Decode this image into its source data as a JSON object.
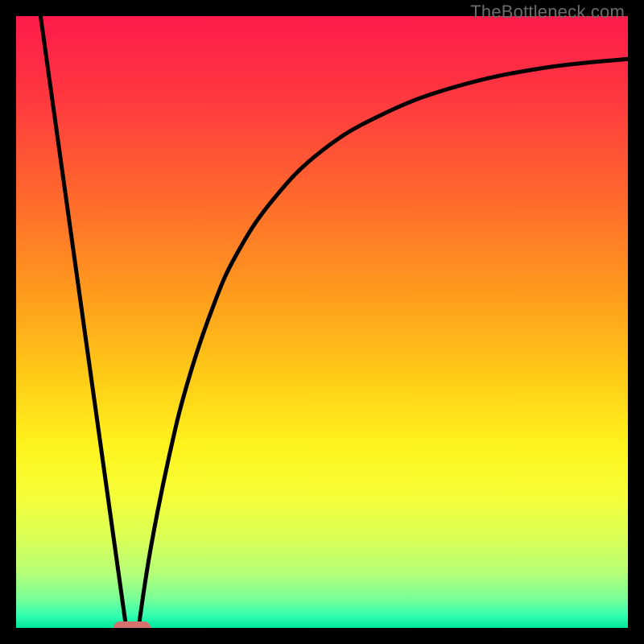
{
  "watermark": "TheBottleneck.com",
  "chart_data": {
    "type": "line",
    "title": "",
    "xlabel": "",
    "ylabel": "",
    "xlim": [
      0,
      100
    ],
    "ylim": [
      0,
      100
    ],
    "grid": false,
    "legend": false,
    "gradient_stops": [
      {
        "offset": 0.0,
        "color": "#ff1a4b"
      },
      {
        "offset": 0.14,
        "color": "#ff3a3f"
      },
      {
        "offset": 0.3,
        "color": "#ff6a2c"
      },
      {
        "offset": 0.45,
        "color": "#ff9a1e"
      },
      {
        "offset": 0.58,
        "color": "#ffc817"
      },
      {
        "offset": 0.7,
        "color": "#fff31c"
      },
      {
        "offset": 0.79,
        "color": "#f5ff3a"
      },
      {
        "offset": 0.86,
        "color": "#d6ff5a"
      },
      {
        "offset": 0.91,
        "color": "#b5ff78"
      },
      {
        "offset": 0.95,
        "color": "#7dff95"
      },
      {
        "offset": 0.98,
        "color": "#32ffb0"
      },
      {
        "offset": 1.0,
        "color": "#00e69c"
      }
    ],
    "series": [
      {
        "name": "left-line",
        "x": [
          4,
          18
        ],
        "y": [
          100,
          0
        ]
      },
      {
        "name": "right-curve",
        "x": [
          20,
          22,
          25,
          28,
          32,
          36,
          42,
          50,
          60,
          72,
          86,
          100
        ],
        "y": [
          0,
          13,
          28,
          40,
          52,
          61,
          70,
          78,
          84,
          88.5,
          91.5,
          93
        ]
      }
    ],
    "marker": {
      "x": 19,
      "y": 0,
      "color": "#d6706d"
    }
  }
}
